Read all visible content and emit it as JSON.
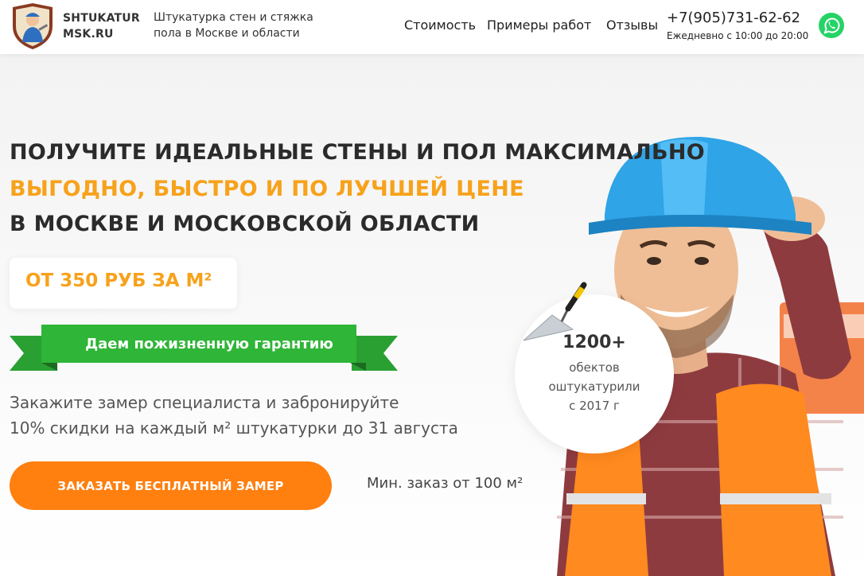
{
  "header": {
    "logo_line1": "SHTUKATUR",
    "logo_line2": "MSK.RU",
    "tagline_line1": "Штукатурка стен и стяжка",
    "tagline_line2": "пола в Москве и области",
    "nav": [
      {
        "label": "Стоимость"
      },
      {
        "label": "Примеры работ"
      },
      {
        "label": "Отзывы"
      }
    ],
    "phone": "+7(905)731-62-62",
    "hours": "Ежедневно с 10:00 до 20:00",
    "whatsapp_icon": "whatsapp-icon"
  },
  "hero": {
    "headline_1": "ПОЛУЧИТЕ ИДЕАЛЬНЫЕ СТЕНЫ И ПОЛ МАКСИМАЛЬНО",
    "headline_2": "ВЫГОДНО, БЫСТРО И ПО ЛУЧШЕЙ ЦЕНЕ",
    "headline_3": "В МОСКВЕ И МОСКОВСКОЙ ОБЛАСТИ",
    "price": "ОТ 350 РУБ ЗА М²",
    "guarantee": "Даем пожизненную гарантию",
    "offer_line1": "Закажите замер специалиста и забронируйте",
    "offer_line2": "10% скидки на каждый м² штукатурки до 31 августа",
    "cta": "ЗАКАЗАТЬ БЕСПЛАТНЫЙ ЗАМЕР",
    "min_order": "Мин. заказ от 100 м²"
  },
  "stat": {
    "number": "1200+",
    "line1": "обектов",
    "line2": "оштукатурили",
    "line3": "с 2017 г"
  },
  "colors": {
    "accent_orange": "#f7a21b",
    "cta_orange": "#ff7f0f",
    "ribbon_green": "#2fb537",
    "whatsapp_green": "#25d366"
  }
}
